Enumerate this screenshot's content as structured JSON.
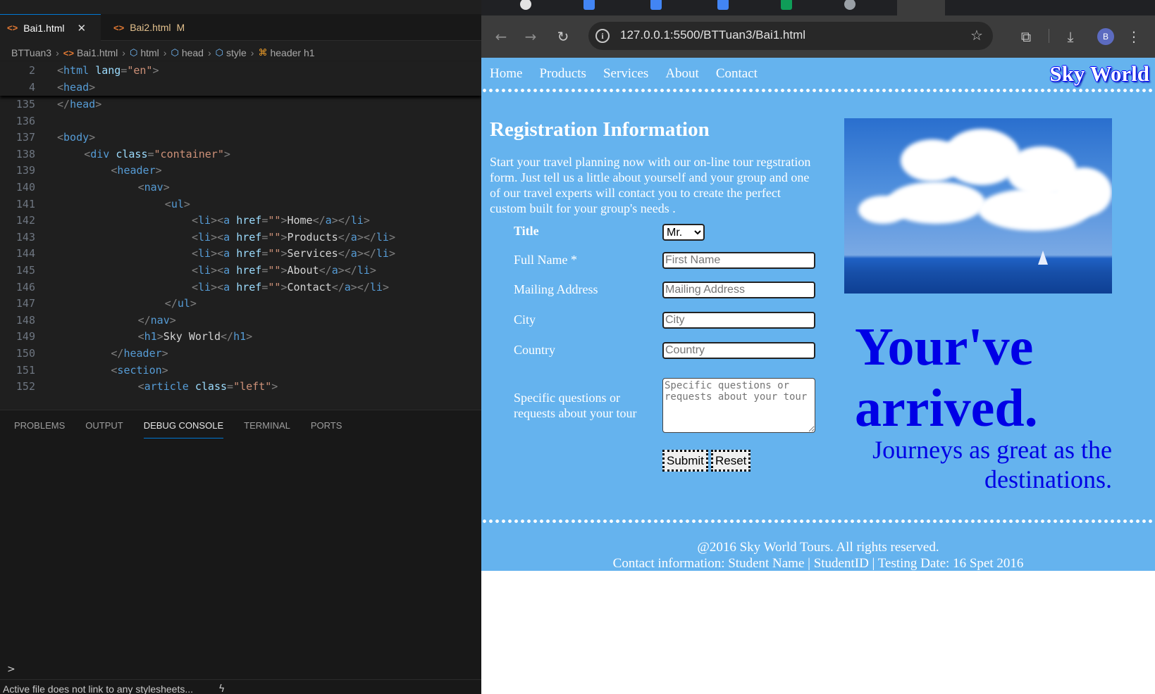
{
  "vscode": {
    "tabs": [
      {
        "label": "Bai1.html",
        "icon": "html-file-icon",
        "close": "✕"
      },
      {
        "label": "Bai2.html",
        "icon": "html-file-icon",
        "badge": "M"
      }
    ],
    "breadcrumb": [
      "BTTuan3",
      "Bai1.html",
      "html",
      "head",
      "style",
      "header h1"
    ],
    "sticky_lines": [
      {
        "num": "2",
        "parts": [
          [
            "punc",
            "<"
          ],
          [
            "tag",
            "html"
          ],
          [
            "text",
            " "
          ],
          [
            "attr",
            "lang"
          ],
          [
            "punc",
            "="
          ],
          [
            "str",
            "\"en\""
          ],
          [
            "punc",
            ">"
          ]
        ]
      },
      {
        "num": "4",
        "parts": [
          [
            "punc",
            "<"
          ],
          [
            "tag",
            "head"
          ],
          [
            "punc",
            ">"
          ]
        ]
      }
    ],
    "code_lines": [
      {
        "num": "135",
        "indent": 0,
        "parts": [
          [
            "punc",
            "</"
          ],
          [
            "tag",
            "head"
          ],
          [
            "punc",
            ">"
          ]
        ]
      },
      {
        "num": "136",
        "indent": 0,
        "parts": []
      },
      {
        "num": "137",
        "indent": 0,
        "parts": [
          [
            "punc",
            "<"
          ],
          [
            "tag",
            "body"
          ],
          [
            "punc",
            ">"
          ]
        ]
      },
      {
        "num": "138",
        "indent": 1,
        "parts": [
          [
            "punc",
            "<"
          ],
          [
            "tag",
            "div"
          ],
          [
            "text",
            " "
          ],
          [
            "attr",
            "class"
          ],
          [
            "punc",
            "="
          ],
          [
            "str",
            "\"container\""
          ],
          [
            "punc",
            ">"
          ]
        ]
      },
      {
        "num": "139",
        "indent": 2,
        "parts": [
          [
            "punc",
            "<"
          ],
          [
            "tag",
            "header"
          ],
          [
            "punc",
            ">"
          ]
        ]
      },
      {
        "num": "140",
        "indent": 3,
        "parts": [
          [
            "punc",
            "<"
          ],
          [
            "tag",
            "nav"
          ],
          [
            "punc",
            ">"
          ]
        ]
      },
      {
        "num": "141",
        "indent": 4,
        "parts": [
          [
            "punc",
            "<"
          ],
          [
            "tag",
            "ul"
          ],
          [
            "punc",
            ">"
          ]
        ]
      },
      {
        "num": "142",
        "indent": 5,
        "parts": [
          [
            "punc",
            "<"
          ],
          [
            "tag",
            "li"
          ],
          [
            "punc",
            "><"
          ],
          [
            "tag",
            "a"
          ],
          [
            "text",
            " "
          ],
          [
            "attr",
            "href"
          ],
          [
            "punc",
            "="
          ],
          [
            "str",
            "\"\""
          ],
          [
            "punc",
            ">"
          ],
          [
            "text",
            "Home"
          ],
          [
            "punc",
            "</"
          ],
          [
            "tag",
            "a"
          ],
          [
            "punc",
            "></"
          ],
          [
            "tag",
            "li"
          ],
          [
            "punc",
            ">"
          ]
        ]
      },
      {
        "num": "143",
        "indent": 5,
        "parts": [
          [
            "punc",
            "<"
          ],
          [
            "tag",
            "li"
          ],
          [
            "punc",
            "><"
          ],
          [
            "tag",
            "a"
          ],
          [
            "text",
            " "
          ],
          [
            "attr",
            "href"
          ],
          [
            "punc",
            "="
          ],
          [
            "str",
            "\"\""
          ],
          [
            "punc",
            ">"
          ],
          [
            "text",
            "Products"
          ],
          [
            "punc",
            "</"
          ],
          [
            "tag",
            "a"
          ],
          [
            "punc",
            "></"
          ],
          [
            "tag",
            "li"
          ],
          [
            "punc",
            ">"
          ]
        ]
      },
      {
        "num": "144",
        "indent": 5,
        "parts": [
          [
            "punc",
            "<"
          ],
          [
            "tag",
            "li"
          ],
          [
            "punc",
            "><"
          ],
          [
            "tag",
            "a"
          ],
          [
            "text",
            " "
          ],
          [
            "attr",
            "href"
          ],
          [
            "punc",
            "="
          ],
          [
            "str",
            "\"\""
          ],
          [
            "punc",
            ">"
          ],
          [
            "text",
            "Services"
          ],
          [
            "punc",
            "</"
          ],
          [
            "tag",
            "a"
          ],
          [
            "punc",
            "></"
          ],
          [
            "tag",
            "li"
          ],
          [
            "punc",
            ">"
          ]
        ]
      },
      {
        "num": "145",
        "indent": 5,
        "parts": [
          [
            "punc",
            "<"
          ],
          [
            "tag",
            "li"
          ],
          [
            "punc",
            "><"
          ],
          [
            "tag",
            "a"
          ],
          [
            "text",
            " "
          ],
          [
            "attr",
            "href"
          ],
          [
            "punc",
            "="
          ],
          [
            "str",
            "\"\""
          ],
          [
            "punc",
            ">"
          ],
          [
            "text",
            "About"
          ],
          [
            "punc",
            "</"
          ],
          [
            "tag",
            "a"
          ],
          [
            "punc",
            "></"
          ],
          [
            "tag",
            "li"
          ],
          [
            "punc",
            ">"
          ]
        ]
      },
      {
        "num": "146",
        "indent": 5,
        "parts": [
          [
            "punc",
            "<"
          ],
          [
            "tag",
            "li"
          ],
          [
            "punc",
            "><"
          ],
          [
            "tag",
            "a"
          ],
          [
            "text",
            " "
          ],
          [
            "attr",
            "href"
          ],
          [
            "punc",
            "="
          ],
          [
            "str",
            "\"\""
          ],
          [
            "punc",
            ">"
          ],
          [
            "text",
            "Contact"
          ],
          [
            "punc",
            "</"
          ],
          [
            "tag",
            "a"
          ],
          [
            "punc",
            "></"
          ],
          [
            "tag",
            "li"
          ],
          [
            "punc",
            ">"
          ]
        ]
      },
      {
        "num": "147",
        "indent": 4,
        "parts": [
          [
            "punc",
            "</"
          ],
          [
            "tag",
            "ul"
          ],
          [
            "punc",
            ">"
          ]
        ]
      },
      {
        "num": "148",
        "indent": 3,
        "parts": [
          [
            "punc",
            "</"
          ],
          [
            "tag",
            "nav"
          ],
          [
            "punc",
            ">"
          ]
        ]
      },
      {
        "num": "149",
        "indent": 3,
        "parts": [
          [
            "punc",
            "<"
          ],
          [
            "tag",
            "h1"
          ],
          [
            "punc",
            ">"
          ],
          [
            "text",
            "Sky World"
          ],
          [
            "punc",
            "</"
          ],
          [
            "tag",
            "h1"
          ],
          [
            "punc",
            ">"
          ]
        ]
      },
      {
        "num": "150",
        "indent": 2,
        "parts": [
          [
            "punc",
            "</"
          ],
          [
            "tag",
            "header"
          ],
          [
            "punc",
            ">"
          ]
        ]
      },
      {
        "num": "151",
        "indent": 2,
        "parts": [
          [
            "punc",
            "<"
          ],
          [
            "tag",
            "section"
          ],
          [
            "punc",
            ">"
          ]
        ]
      },
      {
        "num": "152",
        "indent": 3,
        "parts": [
          [
            "punc",
            "<"
          ],
          [
            "tag",
            "article"
          ],
          [
            "text",
            " "
          ],
          [
            "attr",
            "class"
          ],
          [
            "punc",
            "="
          ],
          [
            "str",
            "\"left\""
          ],
          [
            "punc",
            ">"
          ]
        ]
      }
    ],
    "panel_tabs": [
      "PROBLEMS",
      "OUTPUT",
      "DEBUG CONSOLE",
      "TERMINAL",
      "PORTS"
    ],
    "panel_active": "DEBUG CONSOLE",
    "prompt": ">",
    "status": "Active file does not link to any stylesheets..."
  },
  "chrome": {
    "url": "127.0.0.1:5500/BTTuan3/Bai1.html",
    "avatar": "B",
    "colors": {
      "toolbar": "#3c3c3c",
      "omnibox": "#282828"
    }
  },
  "site": {
    "nav": [
      "Home",
      "Products",
      "Services",
      "About",
      "Contact"
    ],
    "brand": "Sky World",
    "title": "Registration Information",
    "intro": "Start your travel planning now with our on-line tour regstration form. Just tell us a little about yourself and your group and one of our travel experts will contact you to create the perfect custom built for your group's needs .",
    "form": {
      "title_label": "Title",
      "title_value": "Mr.",
      "fullname_label": "Full Name *",
      "fullname_placeholder": "First Name",
      "address_label": "Mailing Address",
      "address_placeholder": "Mailing Address",
      "city_label": "City",
      "city_placeholder": "City",
      "country_label": "Country",
      "country_placeholder": "Country",
      "questions_label": "Specific questions or requests about your tour",
      "questions_placeholder": "Specific questions or requests about your tour",
      "submit": "Submit",
      "reset": "Reset"
    },
    "headline": "Your've arrived.",
    "tagline": "Journeys as great as the destinations.",
    "footer_line1": "@2016 Sky World Tours. All rights reserved.",
    "footer_line2": "Contact information: Student Name | StudentID | Testing Date: 16 Spet 2016",
    "colors": {
      "background": "#65b3ee",
      "headline": "#0000e6"
    }
  }
}
